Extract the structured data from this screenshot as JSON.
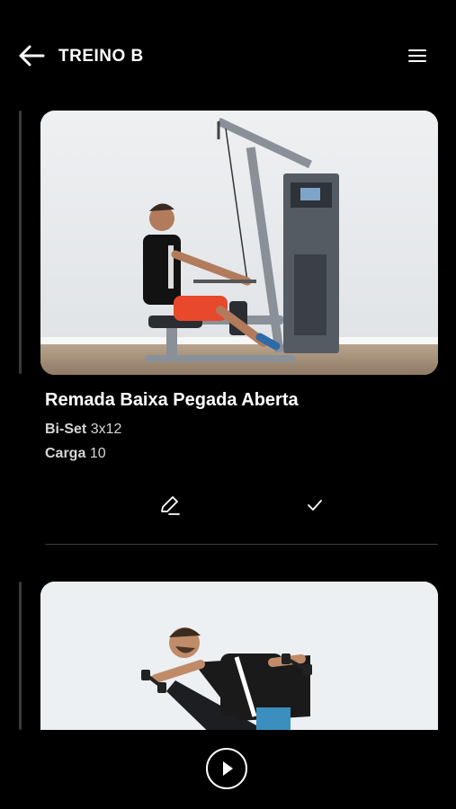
{
  "header": {
    "title": "TREINO B",
    "back_icon": "arrow-left-icon",
    "menu_icon": "hamburger-menu-icon"
  },
  "exercises": [
    {
      "name": "Remada Baixa Pegada Aberta",
      "sets_label": "Bi-Set",
      "sets_value": "3x12",
      "load_label": "Carga",
      "load_value": "10",
      "edit_icon": "pencil-icon",
      "done_icon": "check-icon"
    },
    {
      "name": "",
      "image": "dumbbell-reverse-fly-photo"
    }
  ],
  "footer": {
    "play_icon": "play-icon"
  },
  "colors": {
    "background": "#000000",
    "text": "#ffffff",
    "muted": "#d6d6d6",
    "divider": "#3d3d3d"
  }
}
